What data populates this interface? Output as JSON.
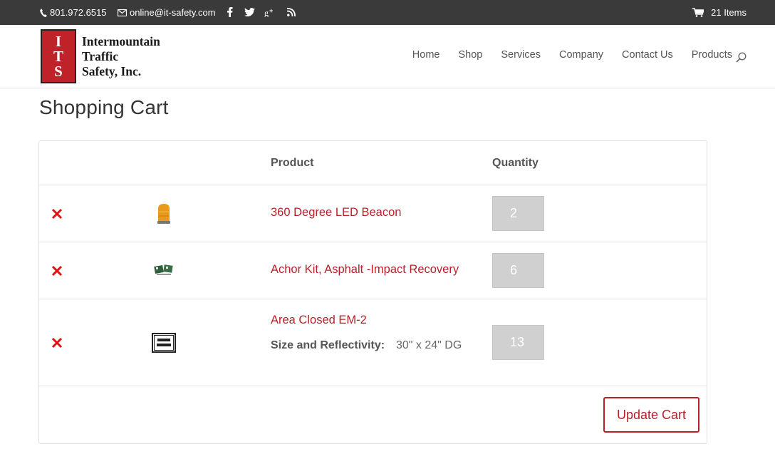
{
  "topbar": {
    "phone": "801.972.6515",
    "email": "online@it-safety.com",
    "social_icons": [
      "facebook-icon",
      "twitter-icon",
      "google-plus-icon",
      "rss-icon"
    ],
    "cart_count": "21 Items"
  },
  "header": {
    "logo": {
      "mark_letters": [
        "I",
        "T",
        "S"
      ],
      "line1": "Intermountain",
      "line2": "Traffic",
      "line3": "Safety, Inc."
    },
    "nav": [
      "Home",
      "Shop",
      "Services",
      "Company",
      "Contact Us",
      "Products"
    ]
  },
  "page": {
    "title": "Shopping Cart"
  },
  "cart": {
    "columns": {
      "product": "Product",
      "quantity": "Quantity"
    },
    "items": [
      {
        "name": "360 Degree LED Beacon",
        "quantity": "2",
        "thumb": "amber-beacon"
      },
      {
        "name": "Achor Kit, Asphalt -Impact Recovery",
        "quantity": "6",
        "thumb": "anchor-kit"
      },
      {
        "name": "Area Closed EM-2",
        "quantity": "13",
        "thumb": "area-closed-sign",
        "variation_label": "Size and Reflectivity:",
        "variation_value": "30\" x 24\" DG"
      }
    ],
    "update_label": "Update Cart"
  },
  "colors": {
    "accent": "#b8202a",
    "topbar": "#3a3a3a",
    "qty_bg": "#d0d0d0"
  }
}
